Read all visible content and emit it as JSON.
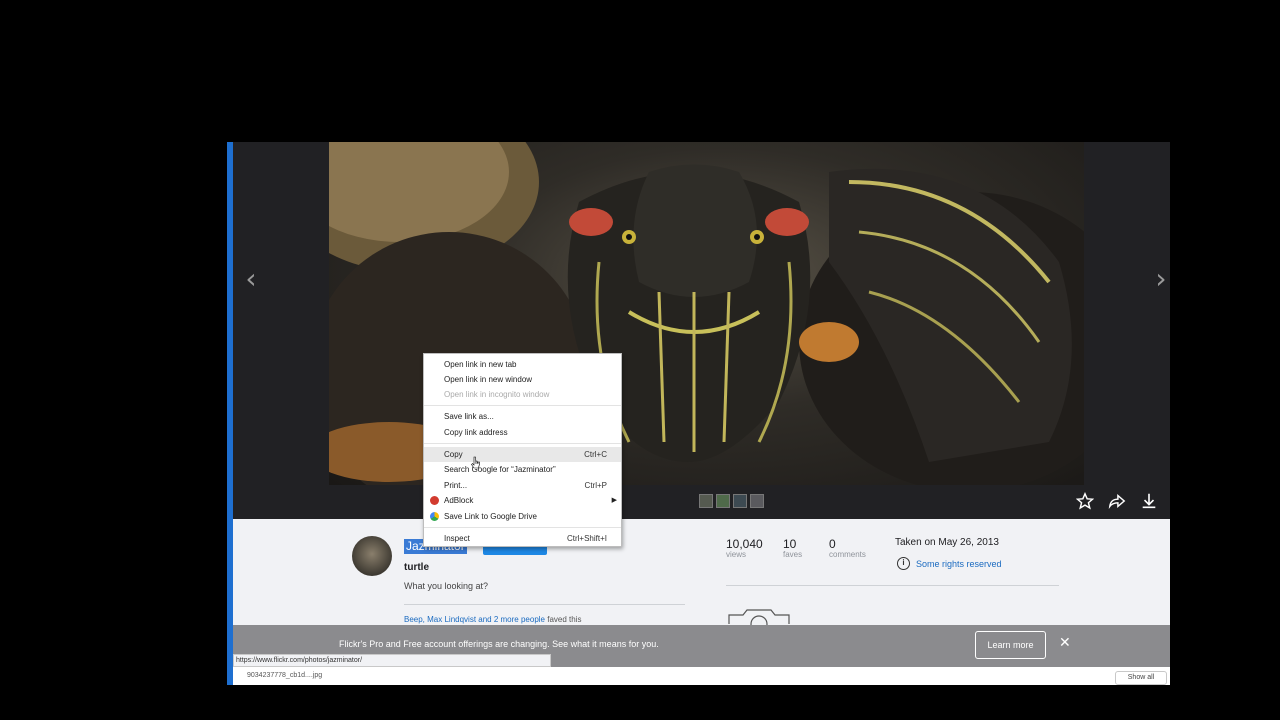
{
  "viewer": {
    "prev_arrow": "‹",
    "next_arrow": "›"
  },
  "owner": {
    "name": "Jazminator",
    "photo_title": "turtle",
    "description": "What you looking at?",
    "faves_prefix": "Beep, Max Lindqvist and",
    "faves_link": "2 more people",
    "faves_suffix": "faved this"
  },
  "stats": {
    "views_num": "10,040",
    "views_label": "views",
    "faves_num": "10",
    "faves_label": "faves",
    "comments_num": "0",
    "comments_label": "comments"
  },
  "meta": {
    "taken": "Taken on May 26, 2013",
    "rights": "Some rights reserved"
  },
  "banner": {
    "text": "Flickr's Pro and Free account offerings are changing. See what it means for you.",
    "learn_more": "Learn more",
    "close": "✕"
  },
  "status_url": "https://www.flickr.com/photos/jazminator/",
  "download": {
    "item": "9034237778_cb1d....jpg",
    "show_all": "Show all"
  },
  "context_menu": {
    "open_new_tab": "Open link in new tab",
    "open_new_window": "Open link in new window",
    "open_incognito": "Open link in incognito window",
    "save_link_as": "Save link as...",
    "copy_link_address": "Copy link address",
    "copy": "Copy",
    "copy_shortcut": "Ctrl+C",
    "search_google": "Search Google for “Jazminator”",
    "print": "Print...",
    "print_shortcut": "Ctrl+P",
    "adblock": "AdBlock",
    "save_to_drive": "Save Link to Google Drive",
    "inspect": "Inspect",
    "inspect_shortcut": "Ctrl+Shift+I"
  },
  "colors": {
    "accent": "#1e88e5",
    "link": "#1b6bc0",
    "banner": "#8b8b8e",
    "viewer_bg": "#212124"
  }
}
